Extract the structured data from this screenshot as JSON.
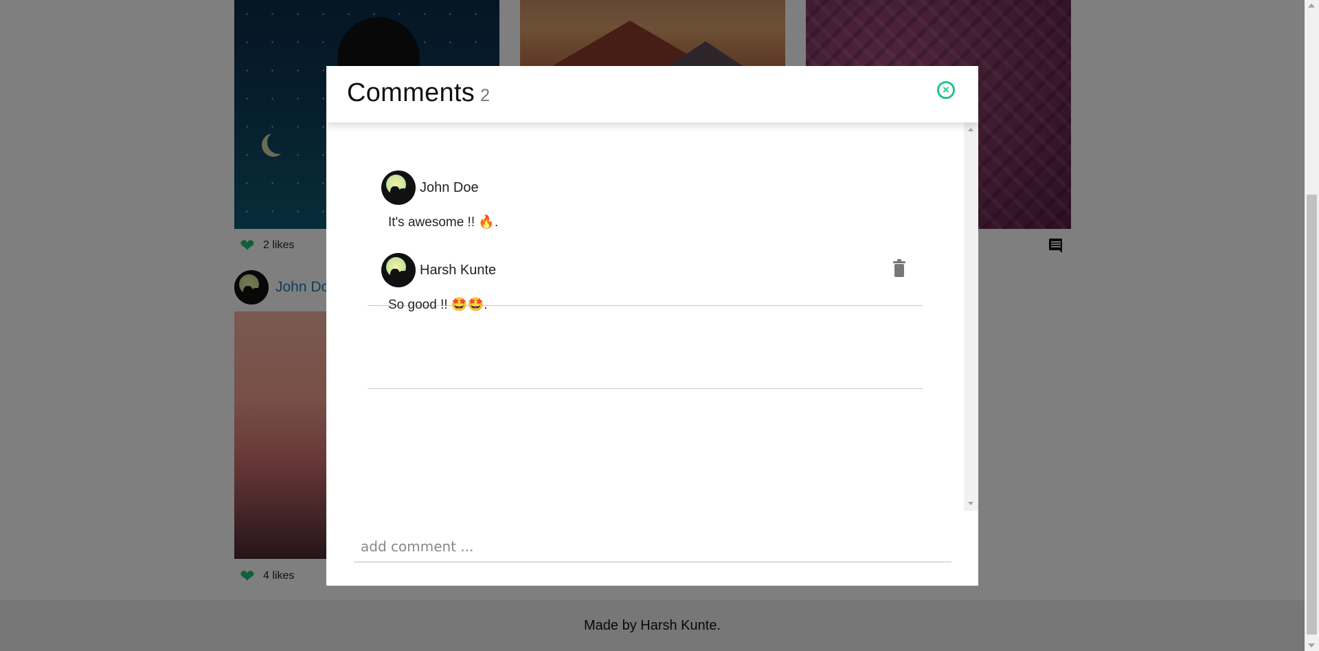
{
  "feed": {
    "post1": {
      "likes_text": "2 likes"
    },
    "post2": {
      "author": "John Doe",
      "likes_text": "4 likes"
    }
  },
  "footer": {
    "text": "Made by Harsh Kunte."
  },
  "modal": {
    "title": "Comments",
    "count": "2",
    "comments": [
      {
        "author": "John Doe",
        "text": "It's awesome !! 🔥."
      },
      {
        "author": "Harsh Kunte",
        "text": "So good !! 🤩🤩."
      }
    ],
    "input": {
      "placeholder": "add comment ...",
      "value": ""
    }
  },
  "colors": {
    "accent": "#1fc38b",
    "like_heart": "#23c17a",
    "author_link": "#1d7fb3",
    "overlay": "rgba(0,0,0,0.5)"
  },
  "icons": {
    "close": "close-circle-icon",
    "delete": "trash-icon",
    "like": "heart-icon",
    "comment": "comment-icon"
  }
}
